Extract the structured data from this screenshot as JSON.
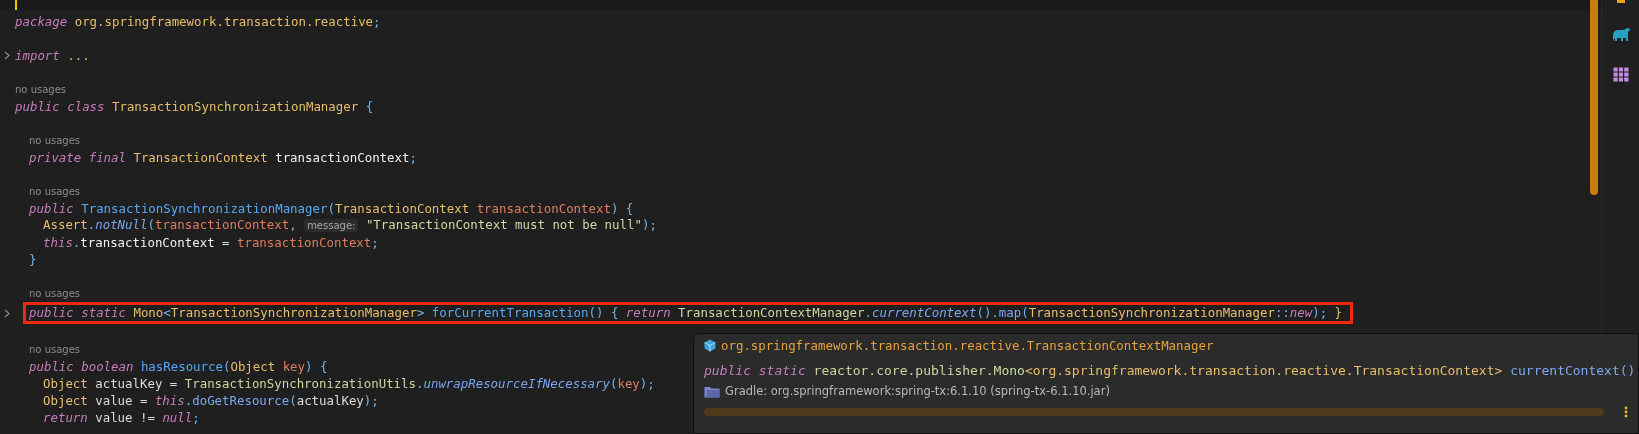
{
  "editor": {
    "lines": [
      {
        "kind": "code",
        "folded": false,
        "highlighted": false,
        "tokens": [
          {
            "text": "package ",
            "kind": "kw"
          },
          {
            "text": "org.springframework.transaction.reactive",
            "kind": "type"
          },
          {
            "text": ";",
            "kind": "punct"
          }
        ]
      },
      {
        "kind": "blank"
      },
      {
        "kind": "code",
        "folded": true,
        "highlighted": false,
        "tokens": [
          {
            "text": "import ",
            "kind": "kw"
          },
          {
            "text": "...",
            "kind": "type"
          }
        ]
      },
      {
        "kind": "blank"
      },
      {
        "kind": "usage",
        "text": "no usages"
      },
      {
        "kind": "code",
        "folded": false,
        "highlighted": false,
        "tokens": [
          {
            "text": "public class ",
            "kind": "kw"
          },
          {
            "text": "TransactionSynchronizationManager ",
            "kind": "type"
          },
          {
            "text": "{",
            "kind": "punct"
          }
        ],
        "children": [
          {
            "kind": "blank"
          },
          {
            "kind": "usage",
            "text": "no usages"
          },
          {
            "kind": "code",
            "folded": false,
            "highlighted": false,
            "tokens": [
              {
                "text": "private final ",
                "kind": "kw"
              },
              {
                "text": "TransactionContext ",
                "kind": "type"
              },
              {
                "text": "transactionContext",
                "kind": "field"
              },
              {
                "text": ";",
                "kind": "punct"
              }
            ]
          },
          {
            "kind": "blank"
          },
          {
            "kind": "usage",
            "text": "no usages"
          },
          {
            "kind": "code",
            "folded": false,
            "highlighted": false,
            "tokens": [
              {
                "text": "public ",
                "kind": "kw"
              },
              {
                "text": "TransactionSynchronizationManager",
                "kind": "decl"
              },
              {
                "text": "(",
                "kind": "punct"
              },
              {
                "text": "TransactionContext ",
                "kind": "type"
              },
              {
                "text": "transactionContext",
                "kind": "param"
              },
              {
                "text": ") {",
                "kind": "punct"
              }
            ],
            "children": [
              {
                "kind": "code",
                "folded": false,
                "highlighted": false,
                "tokens": [
                  {
                    "text": "Assert",
                    "kind": "type"
                  },
                  {
                    "text": ".",
                    "kind": "punct"
                  },
                  {
                    "text": "notNull",
                    "kind": "static"
                  },
                  {
                    "text": "(",
                    "kind": "punct"
                  },
                  {
                    "text": "transactionContext",
                    "kind": "param"
                  },
                  {
                    "text": ", ",
                    "kind": "punct"
                  },
                  {
                    "text": "message:",
                    "kind": "hint"
                  },
                  {
                    "text": " \"TransactionContext must not be null\"",
                    "kind": "string"
                  },
                  {
                    "text": ");",
                    "kind": "punct"
                  }
                ]
              },
              {
                "kind": "code",
                "folded": false,
                "highlighted": false,
                "tokens": [
                  {
                    "text": "this",
                    "kind": "kw"
                  },
                  {
                    "text": ".",
                    "kind": "punct"
                  },
                  {
                    "text": "transactionContext",
                    "kind": "field"
                  },
                  {
                    "text": " = ",
                    "kind": "plain"
                  },
                  {
                    "text": "transactionContext",
                    "kind": "param"
                  },
                  {
                    "text": ";",
                    "kind": "punct"
                  }
                ]
              }
            ]
          },
          {
            "kind": "code",
            "folded": false,
            "highlighted": false,
            "tokens": [
              {
                "text": "}",
                "kind": "punct"
              }
            ]
          },
          {
            "kind": "blank"
          },
          {
            "kind": "usage",
            "text": "no usages"
          },
          {
            "kind": "code",
            "folded": true,
            "highlighted": true,
            "tokens": [
              {
                "text": "public static ",
                "kind": "kw"
              },
              {
                "text": "Mono",
                "kind": "type"
              },
              {
                "text": "<",
                "kind": "punct"
              },
              {
                "text": "TransactionSynchronizationManager",
                "kind": "type"
              },
              {
                "text": "> ",
                "kind": "punct"
              },
              {
                "text": "forCurrentTransaction",
                "kind": "decl"
              },
              {
                "text": "() { ",
                "kind": "punct"
              },
              {
                "text": "return ",
                "kind": "kw"
              },
              {
                "text": "TransactionContextManager",
                "kind": "classref"
              },
              {
                "text": ".",
                "kind": "punct"
              },
              {
                "text": "currentContext",
                "kind": "static"
              },
              {
                "text": "().",
                "kind": "punct"
              },
              {
                "text": "map",
                "kind": "call"
              },
              {
                "text": "(",
                "kind": "punct"
              },
              {
                "text": "TransactionSynchronizationManager",
                "kind": "type"
              },
              {
                "text": "::",
                "kind": "punct"
              },
              {
                "text": "new",
                "kind": "kw"
              },
              {
                "text": "); ",
                "kind": "punct"
              },
              {
                "text": "}",
                "kind": "type"
              }
            ]
          },
          {
            "kind": "blank"
          },
          {
            "kind": "usage",
            "text": "no usages"
          },
          {
            "kind": "code",
            "folded": false,
            "highlighted": false,
            "tokens": [
              {
                "text": "public boolean ",
                "kind": "kw"
              },
              {
                "text": "hasResource",
                "kind": "decl"
              },
              {
                "text": "(",
                "kind": "punct"
              },
              {
                "text": "Object ",
                "kind": "type"
              },
              {
                "text": "key",
                "kind": "param"
              },
              {
                "text": ") {",
                "kind": "punct"
              }
            ],
            "children": [
              {
                "kind": "code",
                "folded": false,
                "highlighted": false,
                "tokens": [
                  {
                    "text": "Object",
                    "kind": "type"
                  },
                  {
                    "text": " actualKey = ",
                    "kind": "plain"
                  },
                  {
                    "text": "TransactionSynchronizationUtils",
                    "kind": "classref"
                  },
                  {
                    "text": ".",
                    "kind": "punct"
                  },
                  {
                    "text": "unwrapResourceIfNecessary",
                    "kind": "static"
                  },
                  {
                    "text": "(",
                    "kind": "punct"
                  },
                  {
                    "text": "key",
                    "kind": "param"
                  },
                  {
                    "text": ");",
                    "kind": "punct"
                  }
                ]
              },
              {
                "kind": "code",
                "folded": false,
                "highlighted": false,
                "tokens": [
                  {
                    "text": "Object",
                    "kind": "type"
                  },
                  {
                    "text": " value = ",
                    "kind": "plain"
                  },
                  {
                    "text": "this",
                    "kind": "kw"
                  },
                  {
                    "text": ".",
                    "kind": "punct"
                  },
                  {
                    "text": "doGetResource",
                    "kind": "call"
                  },
                  {
                    "text": "(",
                    "kind": "punct"
                  },
                  {
                    "text": "actualKey",
                    "kind": "plain"
                  },
                  {
                    "text": ");",
                    "kind": "punct"
                  }
                ]
              },
              {
                "kind": "code",
                "folded": false,
                "highlighted": false,
                "tokens": [
                  {
                    "text": "return",
                    "kind": "kw"
                  },
                  {
                    "text": " value != ",
                    "kind": "plain"
                  },
                  {
                    "text": "null",
                    "kind": "kw"
                  },
                  {
                    "text": ";",
                    "kind": "punct"
                  }
                ]
              }
            ]
          }
        ]
      }
    ]
  },
  "doc_popup": {
    "header": "org.springframework.transaction.reactive.TransactionContextManager",
    "signature": [
      {
        "text": "public static",
        "kind": "kw"
      },
      {
        "text": " reactor.core.publisher.Mono",
        "kind": "classref"
      },
      {
        "text": "<org.springframework.transaction.reactive.TransactionContext>",
        "kind": "type"
      },
      {
        "text": " currentContext()",
        "kind": "call"
      }
    ],
    "source": "Gradle: org.springframework:spring-tx:6.1.10 (spring-tx-6.1.10.jar)"
  }
}
